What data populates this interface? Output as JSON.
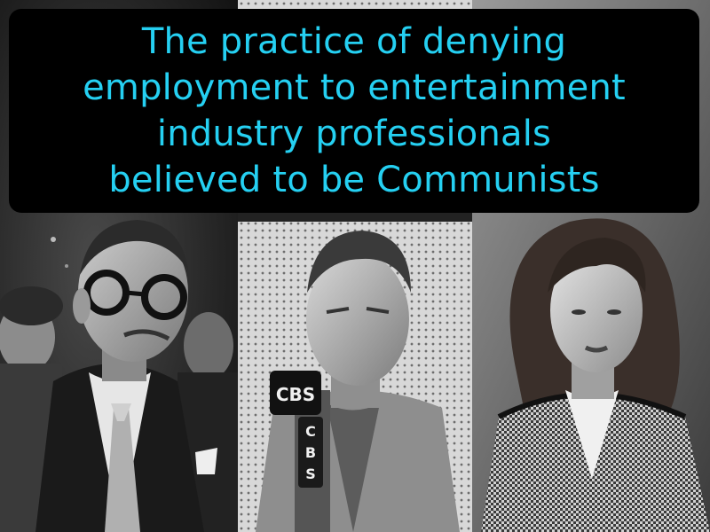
{
  "definition": {
    "lines": [
      "The practice of denying",
      "employment to entertainment",
      "industry professionals",
      "believed to be Communists"
    ]
  },
  "photos": {
    "left": {
      "subject": "man-with-glasses-photo"
    },
    "middle": {
      "subject": "man-at-microphone-photo",
      "mic_label_top": "CBS",
      "mic_label_vertical": [
        "C",
        "B",
        "S"
      ]
    },
    "right": {
      "subject": "woman-in-houndstooth-jacket-photo"
    }
  },
  "colors": {
    "caption_text": "#25d0f2",
    "caption_bg": "#000000"
  }
}
